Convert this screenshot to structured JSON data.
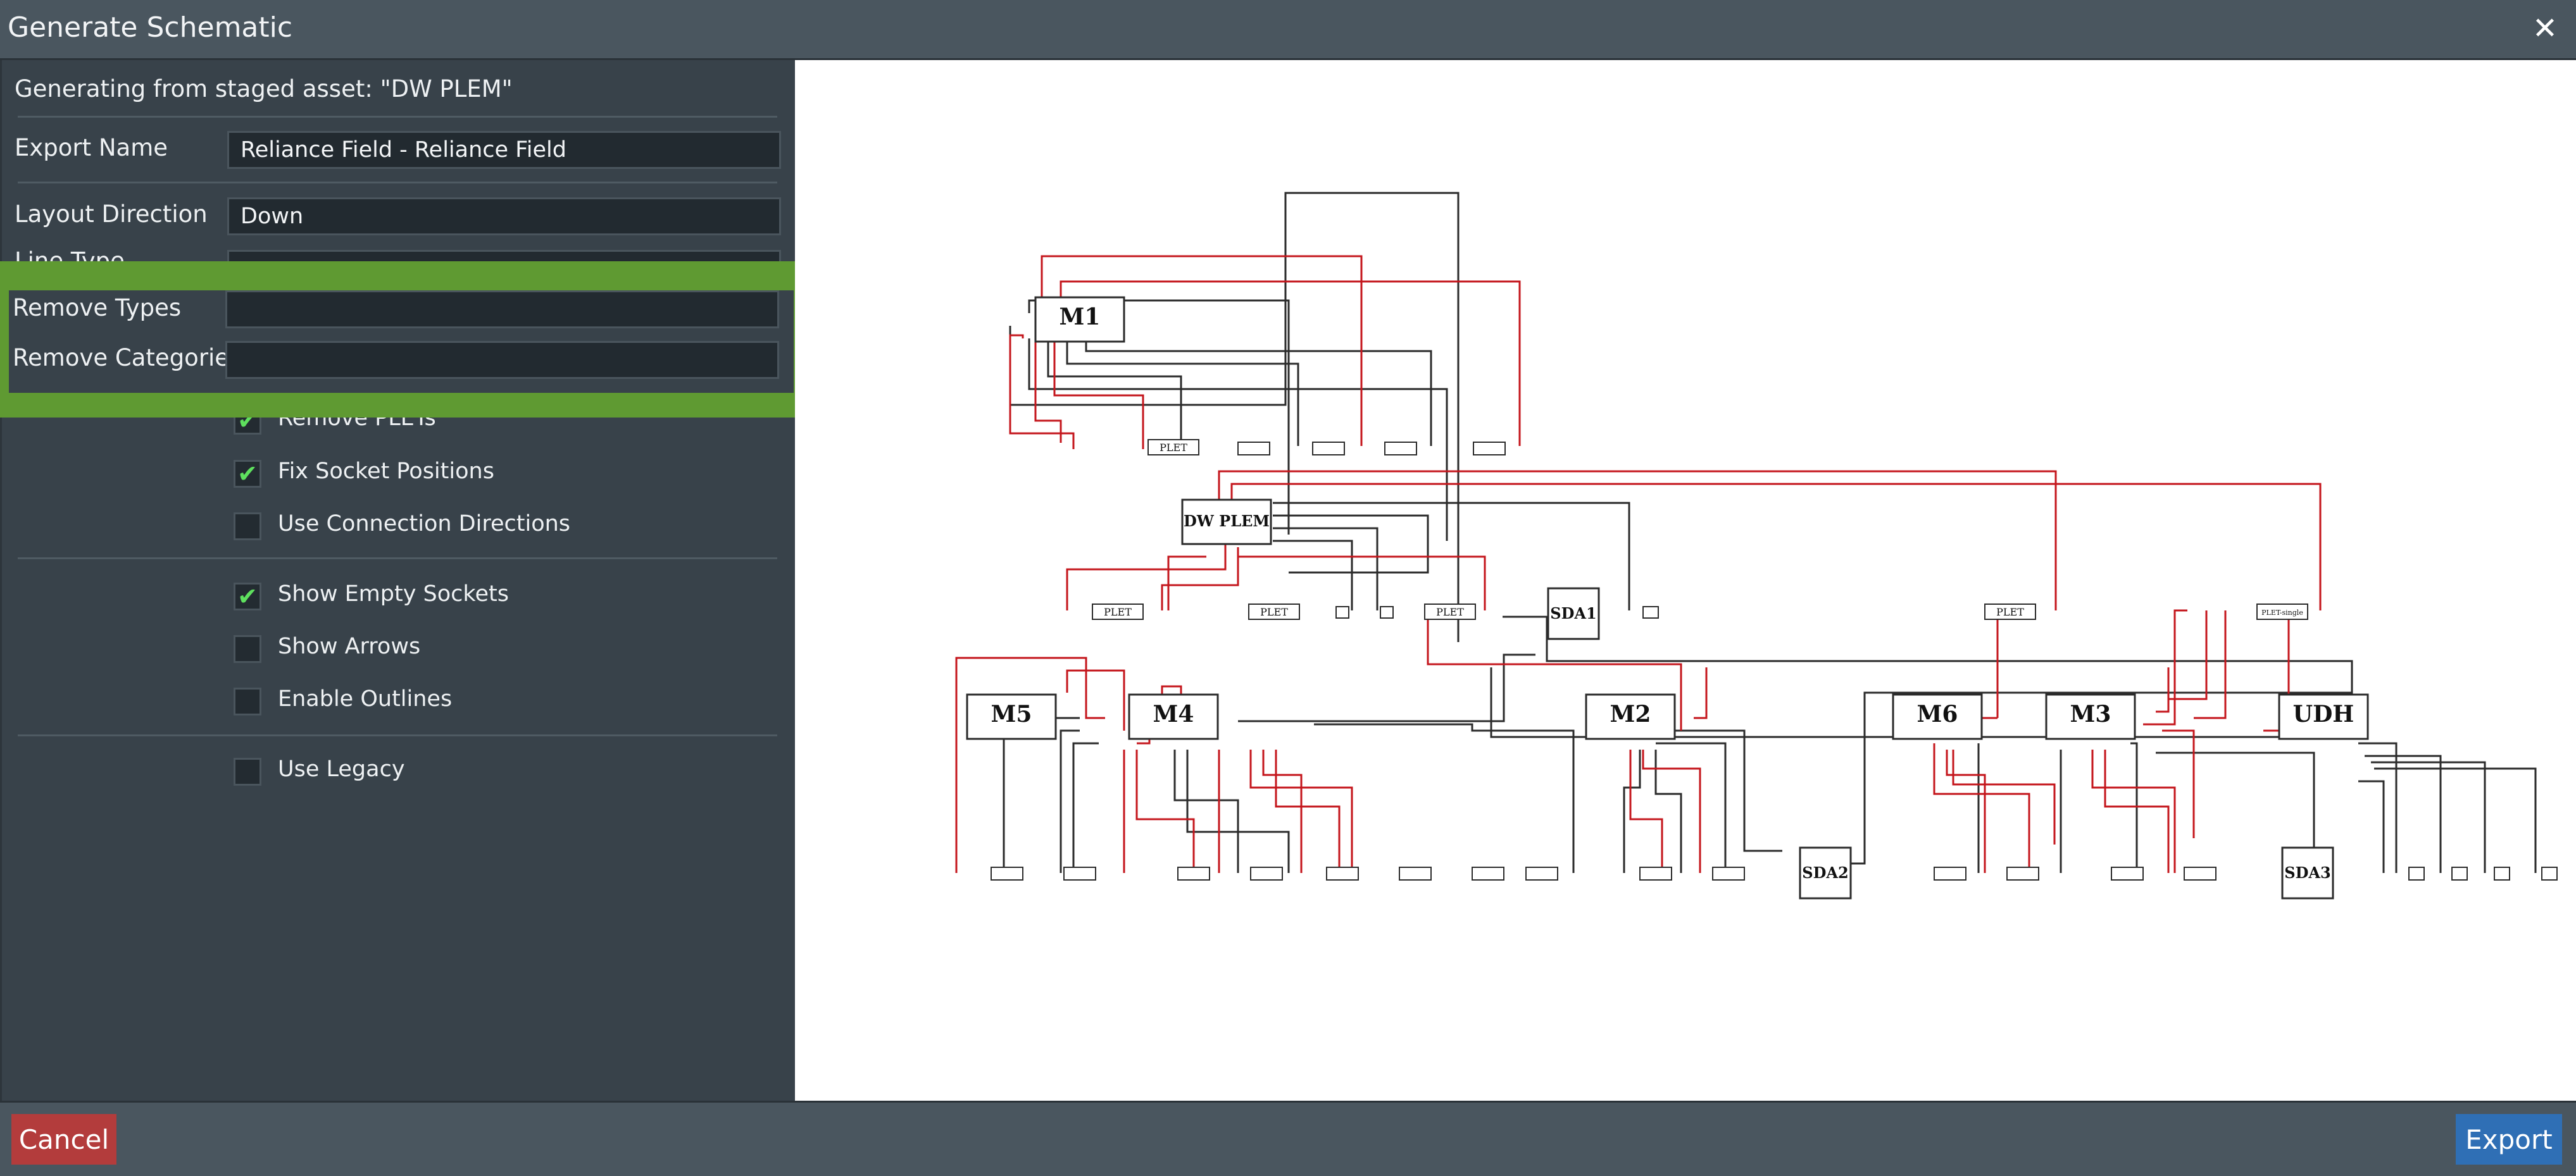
{
  "dialog": {
    "title": "Generate Schematic",
    "close_glyph": "✕"
  },
  "form": {
    "generating_from": "Generating from staged asset: \"DW PLEM\"",
    "export_name_label": "Export Name",
    "export_name_value": "Reliance Field - Reliance Field",
    "layout_direction_label": "Layout Direction",
    "layout_direction_value": "Down",
    "line_type_label_partial": "Line Type",
    "remove_types_label": "Remove Types",
    "remove_types_value": "",
    "remove_categories_label": "Remove Categories",
    "remove_categories_value": "",
    "checkboxes": [
      {
        "label": "Remove PLETs",
        "checked": true
      },
      {
        "label": "Fix Socket Positions",
        "checked": true
      },
      {
        "label": "Use Connection Directions",
        "checked": false
      },
      {
        "label": "Show Empty Sockets",
        "checked": true
      },
      {
        "label": "Show Arrows",
        "checked": false
      },
      {
        "label": "Enable Outlines",
        "checked": false
      },
      {
        "label": "Use Legacy",
        "checked": false
      }
    ],
    "check_glyph": "✔"
  },
  "buttons": {
    "cancel": "Cancel",
    "export": "Export"
  },
  "highlight_color": "#5f9a32",
  "schematic": {
    "line_colors": {
      "red": "#c4161c",
      "black": "#2b2b2b"
    },
    "nodes": [
      {
        "id": "M1",
        "label": "M1"
      },
      {
        "id": "DWPLEM",
        "label": "DW PLEM"
      },
      {
        "id": "SDA1",
        "label": "SDA1"
      },
      {
        "id": "M5",
        "label": "M5"
      },
      {
        "id": "M4",
        "label": "M4"
      },
      {
        "id": "M2",
        "label": "M2"
      },
      {
        "id": "M6",
        "label": "M6"
      },
      {
        "id": "M3",
        "label": "M3"
      },
      {
        "id": "UDH",
        "label": "UDH"
      },
      {
        "id": "SDA2",
        "label": "SDA2"
      },
      {
        "id": "SDA3",
        "label": "SDA3"
      }
    ],
    "small_labels": {
      "plet": "PLET",
      "plet_single": "PLET-single"
    }
  }
}
